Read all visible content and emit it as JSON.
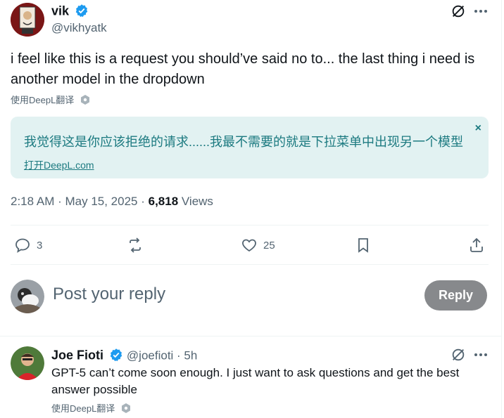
{
  "post": {
    "author_name": "vik",
    "author_handle": "@vikhyatk",
    "text": "i feel like this is a request you should’ve said no to... the last thing i need is another model in the dropdown",
    "translate_label": "使用DeepL翻译",
    "translation": {
      "text": "我觉得这是你应该拒绝的请求......我最不需要的就是下拉菜单中出现另一个模型",
      "link": "打开DeepL.com",
      "close": "×"
    },
    "time": "2:18 AM · May 15, 2025 · ",
    "views_count": "6,818",
    "views_label": " Views",
    "actions": {
      "replies": "3",
      "likes": "25"
    }
  },
  "composer": {
    "placeholder": "Post your reply",
    "button": "Reply"
  },
  "reply": {
    "author_name": "Joe Fioti",
    "author_handle": "@joefioti",
    "time": " · 5h",
    "text": "GPT-5 can’t come soon enough. I just want to ask questions and get the best answer possible",
    "translate_label": "使用DeepL翻译"
  },
  "colors": {
    "verified": "#1d9bf0",
    "translation_bg": "#e2f2f2",
    "translation_text": "#1c7a80",
    "reply_button": "#87898c"
  }
}
